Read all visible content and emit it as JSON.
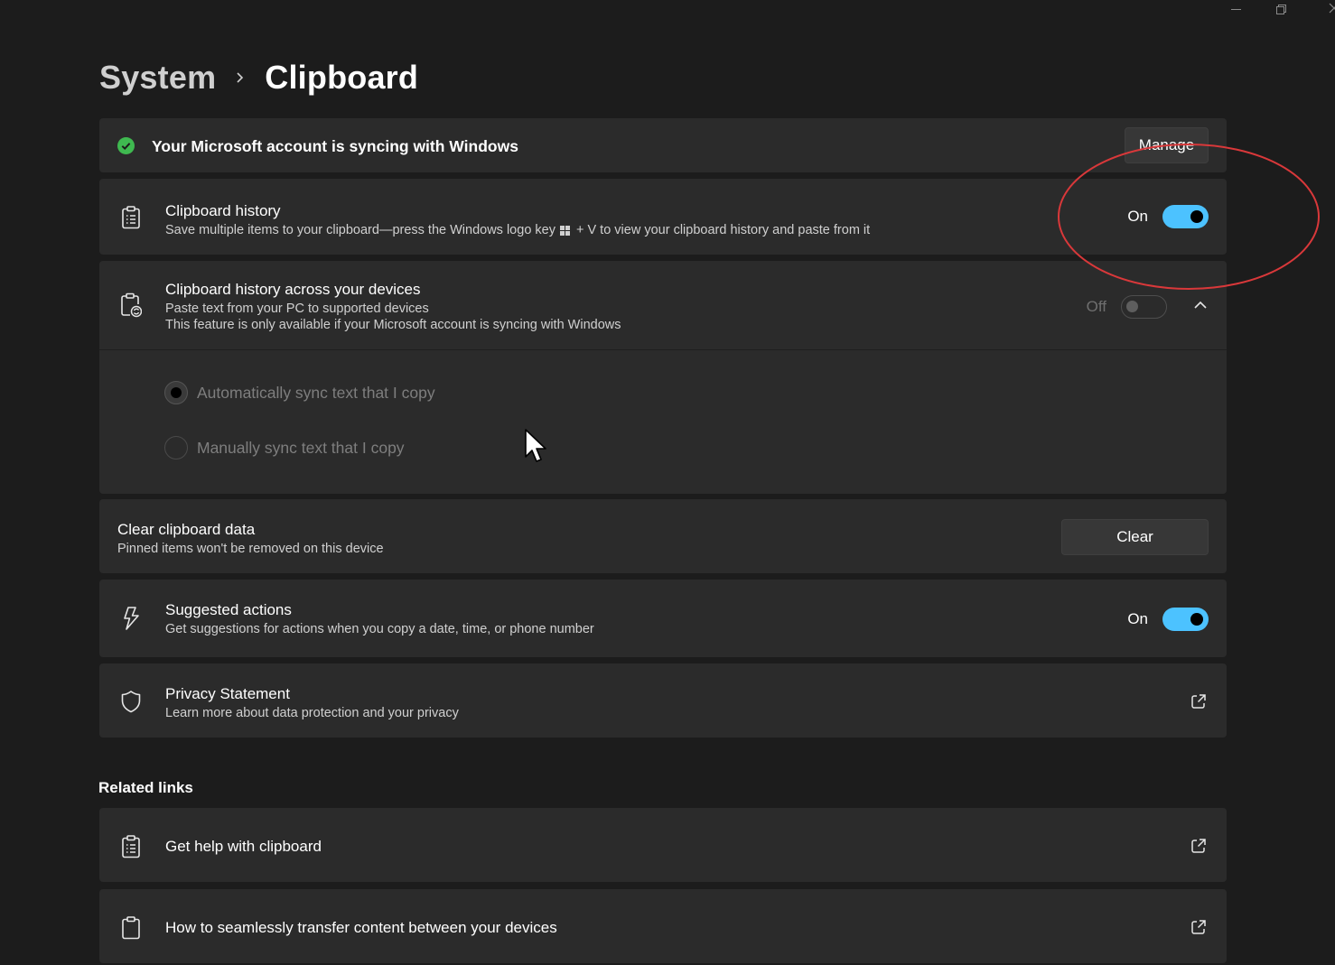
{
  "breadcrumb": {
    "parent": "System",
    "current": "Clipboard"
  },
  "sync_banner": {
    "text": "Your Microsoft account is syncing with Windows",
    "button": "Manage",
    "status_color": "#3fb950"
  },
  "clipboard_history": {
    "title": "Clipboard history",
    "desc_before": "Save multiple items to your clipboard—press the Windows logo key",
    "desc_after": "+ V to view your clipboard history and paste from it",
    "state_label": "On"
  },
  "across_devices": {
    "title": "Clipboard history across your devices",
    "desc1": "Paste text from your PC to supported devices",
    "desc2": "This feature is only available if your Microsoft account is syncing with Windows",
    "state_label": "Off",
    "options": [
      {
        "label": "Automatically sync text that I copy",
        "checked": true
      },
      {
        "label": "Manually sync text that I copy",
        "checked": false
      }
    ]
  },
  "clear_data": {
    "title": "Clear clipboard data",
    "desc": "Pinned items won't be removed on this device",
    "button": "Clear"
  },
  "suggested_actions": {
    "title": "Suggested actions",
    "desc": "Get suggestions for actions when you copy a date, time, or phone number",
    "state_label": "On"
  },
  "privacy": {
    "title": "Privacy Statement",
    "desc": "Learn more about data protection and your privacy"
  },
  "related_links": {
    "heading": "Related links",
    "items": [
      {
        "label": "Get help with clipboard",
        "icon": "clipboard-list-icon"
      },
      {
        "label": "How to seamlessly transfer content between your devices",
        "icon": "clipboard-icon"
      }
    ]
  },
  "colors": {
    "accent": "#4cc2ff",
    "annotation": "#d9383a",
    "card": "#2b2b2b",
    "background": "#1c1c1c"
  }
}
